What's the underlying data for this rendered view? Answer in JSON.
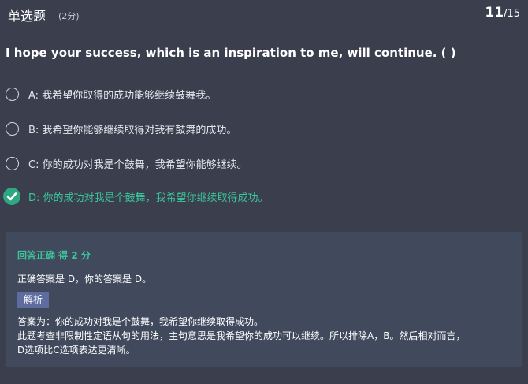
{
  "header": {
    "type_label": "单选题",
    "score_label": "(2分)",
    "current": "11",
    "total": "/15"
  },
  "question": {
    "text": "I hope your success, which is an inspiration to me, will continue. (   )"
  },
  "options": [
    {
      "text": "A: 我希望你取得的成功能够继续鼓舞我。",
      "state": "unselected"
    },
    {
      "text": "B: 我希望你能够继续取得对我有鼓舞的成功。",
      "state": "unselected"
    },
    {
      "text": "C: 你的成功对我是个鼓舞，我希望你能够继续。",
      "state": "unselected"
    },
    {
      "text": "D: 你的成功对我是个鼓舞，我希望你继续取得成功。",
      "state": "selected-correct"
    }
  ],
  "result": {
    "title": "回答正确 得 2 分",
    "answer_line": "正确答案是 D，你的答案是 D。",
    "analysis_tag": "解析",
    "explanation": [
      "答案为：你的成功对我是个鼓舞，我希望你继续取得成功。",
      "此题考查非限制性定语从句的用法，主句意思是我希望你的成功可以继续。所以排除A，B。然后相对而言，",
      "D选项比C选项表达更清晰。"
    ]
  },
  "colors": {
    "background": "#3a3e4d",
    "panel": "#414a5d",
    "correct": "#3cc79b",
    "tag": "#5f6ca0"
  }
}
